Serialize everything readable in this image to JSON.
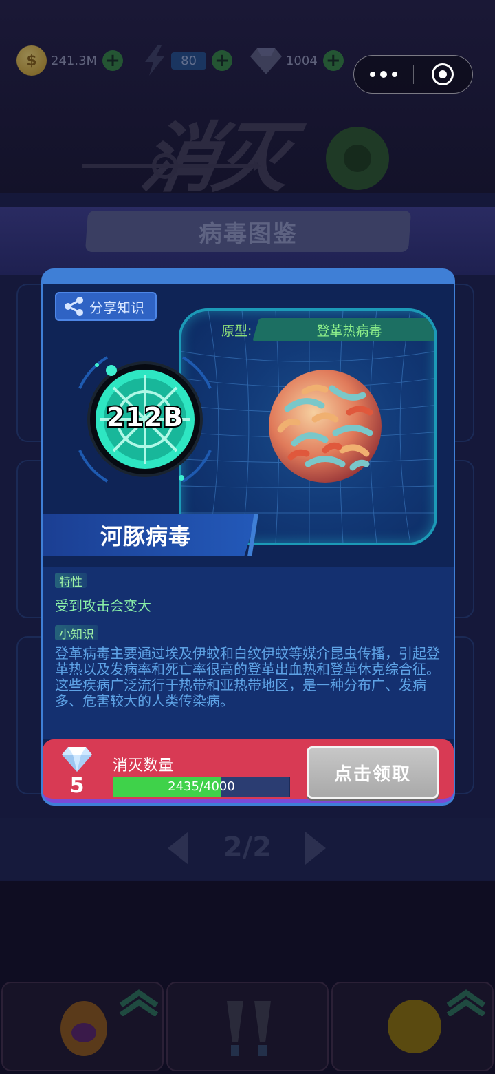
{
  "hud": {
    "coins": "241.3M",
    "energy": "80",
    "gems": "1004"
  },
  "book": {
    "title": "病毒图鉴",
    "page": "2/2"
  },
  "modal": {
    "share_label": "分享知识",
    "prototype_label": "原型:",
    "prototype_name": "登革热病毒",
    "badge_value": "212B",
    "virus_name": "河豚病毒",
    "trait_tag": "特性",
    "trait_text": "受到攻击会变大",
    "knowledge_tag": "小知识",
    "knowledge_text": "登革病毒主要通过埃及伊蚊和白纹伊蚊等媒介昆虫传播，引起登革热以及发病率和死亡率很高的登革出血热和登革休克综合征。这些疾病广泛流行于热带和亚热带地区，是一种分布广、发病多、危害较大的人类传染病。",
    "reward_count": "5",
    "kill_label": "消灭数量",
    "progress_text": "2435/4000",
    "progress_fraction": 0.609,
    "claim_label": "点击领取"
  },
  "colors": {
    "modal_bg": "#0f2456",
    "reward_bar": "#d83a54",
    "progress_fill": "#3fd24a",
    "accent_teal": "#2ee6c2"
  },
  "icons": [
    "coin-icon",
    "bolt-icon",
    "gem-icon",
    "plus-icon",
    "more-icon",
    "close-icon",
    "share-icon",
    "virus-badge-icon",
    "dengue-virus-image",
    "arrow-left-icon",
    "arrow-right-icon"
  ]
}
